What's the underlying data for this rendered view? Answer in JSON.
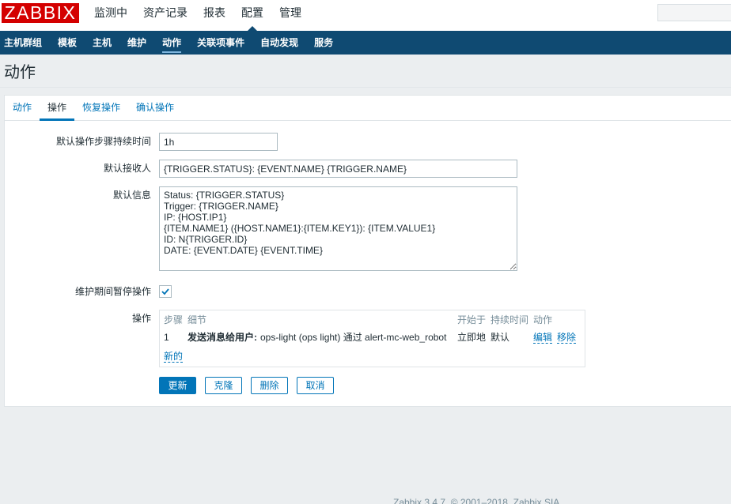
{
  "colors": {
    "brand_red": "#d40000",
    "nav_blue": "#0f4a72",
    "link_blue": "#0275b8",
    "page_bg": "#ebeef0"
  },
  "logo": {
    "text": "ZABBIX"
  },
  "top_menu": {
    "items": [
      {
        "label": "监测中",
        "active": false
      },
      {
        "label": "资产记录",
        "active": false
      },
      {
        "label": "报表",
        "active": false
      },
      {
        "label": "配置",
        "active": true
      },
      {
        "label": "管理",
        "active": false
      }
    ],
    "search": {
      "value": ""
    }
  },
  "sub_menu": {
    "items": [
      {
        "label": "主机群组",
        "active": false
      },
      {
        "label": "模板",
        "active": false
      },
      {
        "label": "主机",
        "active": false
      },
      {
        "label": "维护",
        "active": false
      },
      {
        "label": "动作",
        "active": true
      },
      {
        "label": "关联项事件",
        "active": false
      },
      {
        "label": "自动发现",
        "active": false
      },
      {
        "label": "服务",
        "active": false
      }
    ]
  },
  "page_title": "动作",
  "tabs": [
    {
      "label": "动作",
      "active": false
    },
    {
      "label": "操作",
      "active": true
    },
    {
      "label": "恢复操作",
      "active": false
    },
    {
      "label": "确认操作",
      "active": false
    }
  ],
  "form": {
    "default_step_duration": {
      "label": "默认操作步骤持续时间",
      "value": "1h"
    },
    "default_subject": {
      "label": "默认接收人",
      "value": "{TRIGGER.STATUS}: {EVENT.NAME} {TRIGGER.NAME}"
    },
    "default_message": {
      "label": "默认信息",
      "value": "Status: {TRIGGER.STATUS}\nTrigger: {TRIGGER.NAME}\nIP: {HOST.IP1}\n{ITEM.NAME1} ({HOST.NAME1}:{ITEM.KEY1}): {ITEM.VALUE1}\nID: N{TRIGGER.ID}\nDATE: {EVENT.DATE} {EVENT.TIME}"
    },
    "pause_in_maintenance": {
      "label": "维护期间暂停操作",
      "checked": true,
      "icon": "check-icon"
    },
    "operations": {
      "label": "操作",
      "columns": {
        "step": "步骤",
        "details": "细节",
        "start_in": "开始于",
        "duration": "持续时间",
        "action": "动作"
      },
      "rows": [
        {
          "step": "1",
          "details_type": "发送消息给用户:",
          "details_text": "ops-light (ops light) 通过 alert-mc-web_robot",
          "start_in": "立即地",
          "duration": "默认",
          "edit": "编辑",
          "remove": "移除"
        }
      ],
      "new_link": "新的"
    }
  },
  "buttons": {
    "update": "更新",
    "clone": "克隆",
    "delete": "删除",
    "cancel": "取消"
  },
  "footer": {
    "text": "Zabbix 3.4.7. © 2001–2018, Zabbix SIA"
  }
}
